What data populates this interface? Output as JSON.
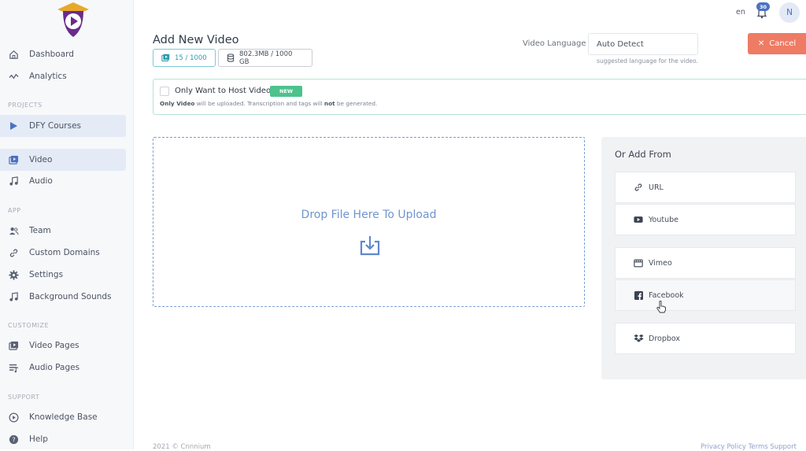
{
  "sidebar": {
    "items_top": [
      {
        "label": "Dashboard",
        "icon": "home-icon"
      },
      {
        "label": "Analytics",
        "icon": "activity-icon"
      }
    ],
    "sections": {
      "projects": "PROJECTS",
      "app": "APP",
      "customize": "CUSTOMIZE",
      "support": "SUPPORT"
    },
    "projects": [
      {
        "label": "DFY Courses",
        "icon": "play-icon"
      }
    ],
    "media": [
      {
        "label": "Video",
        "icon": "video-icon"
      },
      {
        "label": "Audio",
        "icon": "music-icon"
      }
    ],
    "app": [
      {
        "label": "Team",
        "icon": "users-icon"
      },
      {
        "label": "Custom Domains",
        "icon": "link-icon"
      },
      {
        "label": "Settings",
        "icon": "gear-icon"
      },
      {
        "label": "Background Sounds",
        "icon": "music-icon"
      }
    ],
    "customize": [
      {
        "label": "Video Pages",
        "icon": "video-pages-icon"
      },
      {
        "label": "Audio Pages",
        "icon": "audio-pages-icon"
      }
    ],
    "support": [
      {
        "label": "Knowledge Base",
        "icon": "play-circle-icon"
      },
      {
        "label": "Help",
        "icon": "help-icon"
      }
    ]
  },
  "header": {
    "lang": "en",
    "notifications": "30",
    "avatar": "N"
  },
  "page": {
    "title": "Add New Video",
    "video_count": "15 / 1000",
    "storage": "802.3MB / 1000 GB",
    "language_label": "Video Language :",
    "language_value": "Auto Detect",
    "language_help": "suggested language for the video.",
    "cancel": "Cancel"
  },
  "host": {
    "label": "Only Want to Host Video",
    "badge": "NEW",
    "note_1": "Only Video",
    "note_2": " will be uploaded. Transcription and tags will ",
    "note_3": "not",
    "note_4": " be generated."
  },
  "dropzone": {
    "text": "Drop File Here To Upload"
  },
  "addfrom": {
    "title": "Or Add From",
    "sources": [
      {
        "label": "URL",
        "icon": "link-icon"
      },
      {
        "label": "Youtube",
        "icon": "youtube-icon"
      },
      {
        "label": "Vimeo",
        "icon": "vimeo-icon"
      },
      {
        "label": "Facebook",
        "icon": "facebook-icon"
      },
      {
        "label": "Dropbox",
        "icon": "dropbox-icon"
      }
    ]
  },
  "footer": {
    "copyright": "2021 © Cnnnium",
    "links": "Privacy Policy  Terms  Support"
  },
  "colors": {
    "accent": "#4a72c2",
    "cancel": "#ee7b63",
    "new_badge": "#4cc28d"
  }
}
